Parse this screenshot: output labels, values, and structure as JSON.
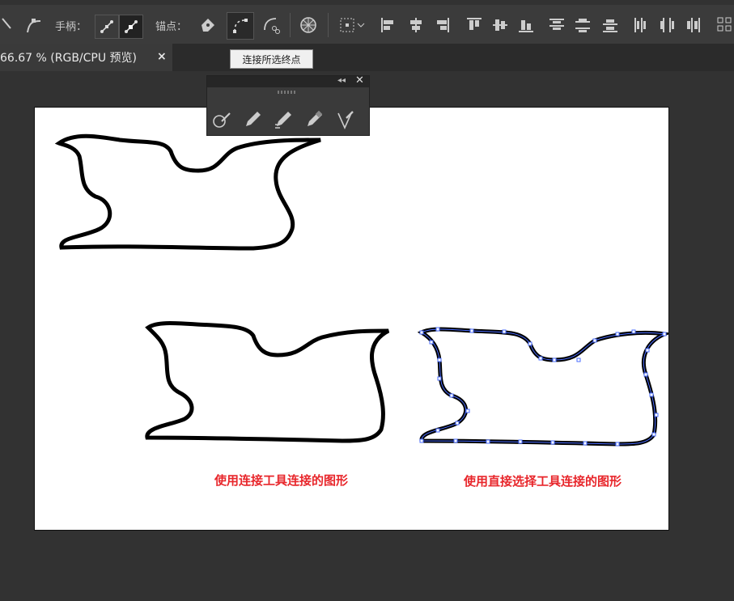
{
  "toolbar": {
    "handle_label": "手柄：",
    "anchor_label": "锚点：",
    "icons": [
      "select-arrow-icon",
      "convert-anchor-icon",
      "handle-broken-icon",
      "handle-smooth-icon",
      "pen-anchor-icon",
      "connect-endpoints-icon",
      "cut-path-icon",
      "recolor-wheel-icon",
      "transform-grid-icon",
      "align-left-icon",
      "align-hcenter-icon",
      "align-right-icon",
      "align-top-icon",
      "align-vcenter-icon",
      "align-bottom-icon",
      "distribute-top-icon",
      "distribute-vcenter-icon",
      "distribute-bottom-icon",
      "distribute-left-icon",
      "distribute-hcenter-icon",
      "distribute-right-icon",
      "more-options-icon"
    ]
  },
  "tab": {
    "title": "66.67 % (RGB/CPU 预览)",
    "close": "×"
  },
  "tooltip": "连接所选终点",
  "panel": {
    "collapse": "◂◂",
    "close": "✕",
    "tools": [
      "shaper-tool-icon",
      "pencil-tool-icon",
      "smooth-tool-icon",
      "path-eraser-tool-icon",
      "join-tool-icon"
    ]
  },
  "captions": {
    "left": "使用连接工具连接的图形",
    "right": "使用直接选择工具连接的图形"
  },
  "colors": {
    "app_bg": "#323232",
    "toolbar_bg": "#3b3b3b",
    "caption": "#e8262b",
    "selection": "#4a6cff"
  }
}
